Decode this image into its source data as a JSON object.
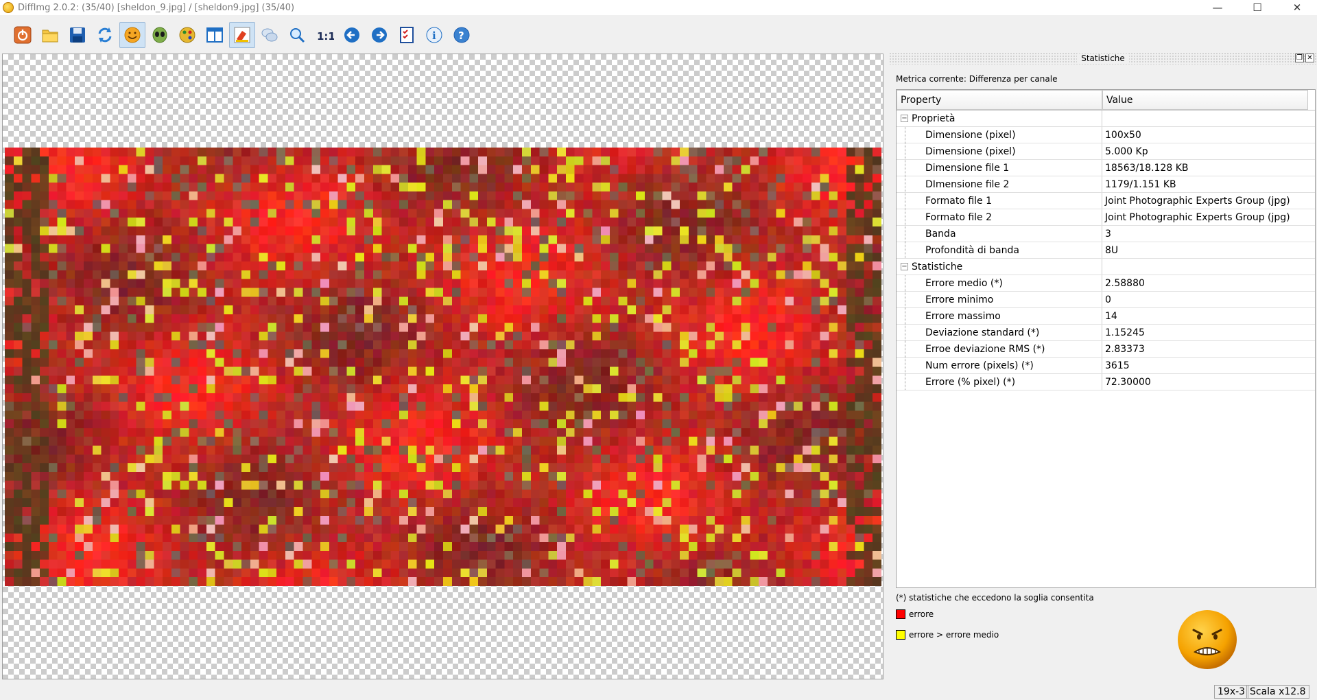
{
  "window": {
    "title": "DiffImg 2.0.2:  (35/40) [sheldon_9.jpg] / [sheldon9.jpg] (35/40)",
    "minimize": "—",
    "maximize": "☐",
    "close": "✕"
  },
  "toolbar": {
    "buttons": [
      {
        "icon": "power-icon"
      },
      {
        "icon": "folder-open-icon"
      },
      {
        "icon": "save-icon"
      },
      {
        "icon": "refresh-icon"
      },
      {
        "icon": "smiley-icon",
        "active": true
      },
      {
        "icon": "alien-icon"
      },
      {
        "icon": "palette-icon"
      },
      {
        "icon": "split-view-icon"
      },
      {
        "icon": "highlight-icon",
        "active": true
      },
      {
        "icon": "chat-icon"
      },
      {
        "icon": "zoom-fit-icon"
      },
      {
        "icon": "zoom-1-1-icon",
        "label": "1:1"
      },
      {
        "icon": "arrow-left-icon"
      },
      {
        "icon": "arrow-right-icon"
      },
      {
        "icon": "checklist-icon"
      },
      {
        "icon": "info-icon"
      },
      {
        "icon": "help-icon"
      }
    ]
  },
  "colors": {
    "error": "#ff0000",
    "error_above_mean": "#ffff00",
    "accent_blue": "#1f6fc4"
  },
  "panel": {
    "title": "Statistiche",
    "metric": "Metrica corrente: Differenza per canale",
    "table": {
      "col_property": "Property",
      "col_value": "Value",
      "groups": [
        {
          "name": "Proprietà",
          "rows": [
            {
              "property": "Dimensione (pixel)",
              "value": "100x50"
            },
            {
              "property": "Dimensione (pixel)",
              "value": "5.000 Kp"
            },
            {
              "property": "Dimensione file 1",
              "value": "18563/18.128 KB"
            },
            {
              "property": "DImensione file 2",
              "value": "1179/1.151 KB"
            },
            {
              "property": "Formato file 1",
              "value": "Joint Photographic Experts Group (jpg)"
            },
            {
              "property": "Formato file 2",
              "value": "Joint Photographic Experts Group (jpg)"
            },
            {
              "property": "Banda",
              "value": "3"
            },
            {
              "property": "Profondità di banda",
              "value": "8U"
            }
          ]
        },
        {
          "name": "Statistiche",
          "rows": [
            {
              "property": "Errore medio (*)",
              "value": "2.58880"
            },
            {
              "property": "Errore minimo",
              "value": "0"
            },
            {
              "property": "Errore massimo",
              "value": "14"
            },
            {
              "property": "Deviazione standard (*)",
              "value": "1.15245"
            },
            {
              "property": "Erroe deviazione RMS (*)",
              "value": "2.83373"
            },
            {
              "property": "Num errore (pixels) (*)",
              "value": "3615"
            },
            {
              "property": "Errore (% pixel) (*)",
              "value": "72.30000"
            }
          ]
        }
      ]
    },
    "footnote": "(*) statistiche che eccedono la soglia consentita",
    "legend": [
      {
        "label": "errore",
        "color": "#ff0000"
      },
      {
        "label": "errore > errore medio",
        "color": "#ffff00"
      }
    ]
  },
  "status": {
    "coords": "19x-3",
    "scale": "Scala x12.8"
  }
}
